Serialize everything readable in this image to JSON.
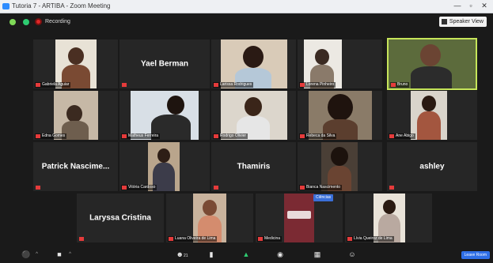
{
  "window": {
    "title": "Tutoria 7 - ARTIBA - Zoom Meeting",
    "minimize": "—",
    "restore": "▫",
    "close": "✕"
  },
  "status": {
    "recording": "Recording",
    "speaker_view": "Speaker View"
  },
  "participants": [
    {
      "name": "Gabriela Aguiar",
      "video": true
    },
    {
      "name": "Yael Berman",
      "video": false
    },
    {
      "name": "Larissa Rodrigues",
      "video": true
    },
    {
      "name": "Lorena Pinheiro",
      "video": true
    },
    {
      "name": "Bruno",
      "video": true,
      "speaking": true
    },
    {
      "name": "Edna Gomes",
      "video": true
    },
    {
      "name": "Matheus Ferreira",
      "video": true
    },
    {
      "name": "Rodrigo Olivier",
      "video": true
    },
    {
      "name": "Rebeca da Silva",
      "video": true
    },
    {
      "name": "Ane Abigo",
      "video": true
    },
    {
      "name": "Patrick  Nascime...",
      "video": false
    },
    {
      "name": "Vitória Cardoso",
      "video": true
    },
    {
      "name": "Thamiris",
      "video": false
    },
    {
      "name": "Bianca Nascimento",
      "video": true
    },
    {
      "name": "ashley",
      "video": false
    },
    {
      "name": "Laryssa Cristina",
      "video": false
    },
    {
      "name": "Luana Oliveira de Lima",
      "video": true
    },
    {
      "name": "Medicina",
      "video": true
    },
    {
      "name": "Lívia Queiroz de Lima",
      "video": true
    }
  ],
  "talking_badge": "Ciências",
  "toolbar": {
    "items": [
      {
        "name": "mute",
        "icon": "microphone-icon"
      },
      {
        "name": "video",
        "icon": "video-camera-icon"
      },
      {
        "name": "participants",
        "icon": "participants-icon",
        "count": "21"
      },
      {
        "name": "chat",
        "icon": "chat-icon"
      },
      {
        "name": "share",
        "icon": "share-screen-icon"
      },
      {
        "name": "record",
        "icon": "record-icon"
      },
      {
        "name": "breakout",
        "icon": "breakout-rooms-icon"
      },
      {
        "name": "reactions",
        "icon": "reactions-icon"
      }
    ],
    "leave": "Leave Room"
  },
  "colors": {
    "active_speaker": "#c6e55a",
    "muted": "#e53b3b",
    "share": "#2ecc71",
    "leave": "#2f6fe6"
  }
}
